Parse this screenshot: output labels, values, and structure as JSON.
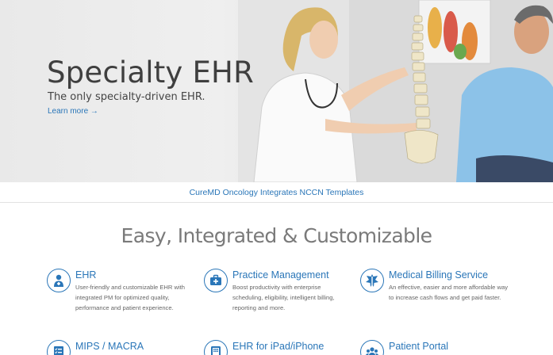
{
  "hero": {
    "title": "Specialty EHR",
    "subtitle": "The only specialty-driven EHR.",
    "link_label": "Learn more →"
  },
  "news": {
    "link_label": "CureMD Oncology Integrates NCCN Templates"
  },
  "section": {
    "title": "Easy, Integrated & Customizable"
  },
  "features": [
    {
      "title": "EHR",
      "description": "User-friendly and customizable EHR with integrated PM for optimized quality, performance and patient experience.",
      "icon": "doctor-icon"
    },
    {
      "title": "Practice Management",
      "description": "Boost productivity with enterprise scheduling, eligibility, intelligent billing, reporting and more.",
      "icon": "medical-kit-icon"
    },
    {
      "title": "Medical Billing Service",
      "description": "An effective, easier and more affordable way to increase cash flows and get paid faster.",
      "icon": "caduceus-icon"
    },
    {
      "title": "MIPS / MACRA",
      "description": "",
      "icon": "checklist-icon"
    },
    {
      "title": "EHR for iPad/iPhone",
      "description": "",
      "icon": "tablet-icon"
    },
    {
      "title": "Patient Portal",
      "description": "",
      "icon": "patients-group-icon"
    }
  ],
  "colors": {
    "accent": "#2a76b8",
    "heading": "#3f3f3f",
    "muted": "#7a7a7a"
  }
}
